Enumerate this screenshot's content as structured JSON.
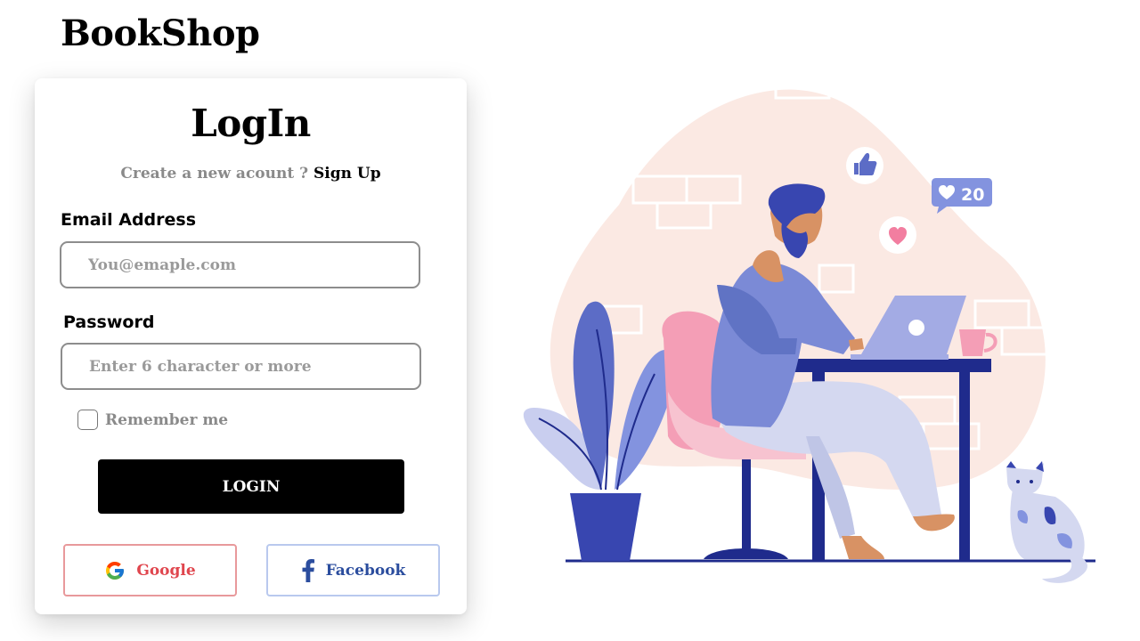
{
  "app": {
    "brand": "BookShop"
  },
  "login": {
    "title": "LogIn",
    "signup_prompt": "Create a new acount ?",
    "signup_link": "Sign Up",
    "email_label": "Email Address",
    "email_placeholder": "You@emaple.com",
    "password_label": "Password",
    "password_placeholder": "Enter 6 character or more",
    "remember_label": "Remember me",
    "login_button": "LOGIN",
    "google_button": "Google",
    "facebook_button": "Facebook"
  },
  "illustration": {
    "likes_count": "20"
  },
  "colors": {
    "primary": "#000000",
    "google_red": "#e0464e",
    "facebook_blue": "#2b4d9e",
    "illus_blob": "#fbe9e3",
    "illus_navy": "#1f2b8c",
    "illus_purple": "#7b8ad6"
  },
  "icons": [
    "google-icon",
    "facebook-icon",
    "thumbs-up-icon",
    "heart-icon"
  ]
}
